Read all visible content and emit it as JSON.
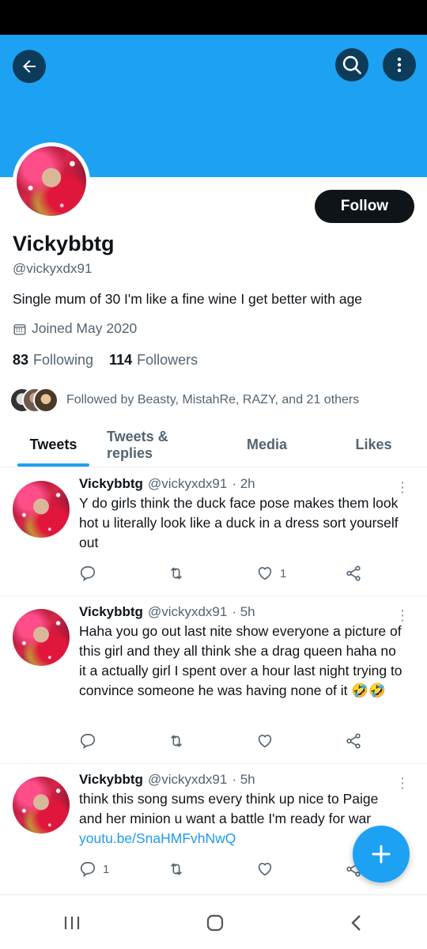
{
  "profile": {
    "display_name": "Vickybbtg",
    "handle": "@vickyxdx91",
    "bio": "Single mum of 30 I'm like a fine wine I get better with age",
    "joined": "Joined May 2020",
    "following_count": "83",
    "following_label": "Following",
    "followers_count": "114",
    "followers_label": "Followers",
    "followed_by": "Followed by Beasty, MistahRe, RAZY, and 21 others",
    "follow_button": "Follow"
  },
  "tabs": [
    {
      "label": "Tweets",
      "active": true
    },
    {
      "label": "Tweets & replies",
      "active": false
    },
    {
      "label": "Media",
      "active": false
    },
    {
      "label": "Likes",
      "active": false
    }
  ],
  "tweets": [
    {
      "name": "Vickybbtg",
      "handle": "@vickyxdx91",
      "time": "· 2h",
      "text": "Y do girls think the duck face pose makes them look hot u literally look like a duck in a dress sort yourself out",
      "link": "",
      "replies": "",
      "retweets": "",
      "likes": "1"
    },
    {
      "name": "Vickybbtg",
      "handle": "@vickyxdx91",
      "time": "· 5h",
      "text": "Haha you go out last nite show everyone a picture of this girl and they all think she a drag queen haha no it a actually girl I spent over a hour last night trying to convince someone he was having none of it 🤣🤣",
      "link": "",
      "replies": "",
      "retweets": "",
      "likes": ""
    },
    {
      "name": "Vickybbtg",
      "handle": "@vickyxdx91",
      "time": "· 5h",
      "text": "think this song sums every think up nice to Paige and her minion u want a battle I'm ready for war",
      "link": "youtu.be/SnaHMFvhNwQ",
      "replies": "1",
      "retweets": "",
      "likes": ""
    }
  ],
  "colors": {
    "brand": "#1da1f2",
    "banner": "#1da1f2",
    "text": "#0f1419",
    "secondary": "#536471",
    "link": "#1d9bf0"
  },
  "icons": {
    "back": "arrow-left-icon",
    "search": "search-icon",
    "menu": "more-vertical-icon",
    "calendar": "calendar-icon",
    "reply": "reply-icon",
    "retweet": "retweet-icon",
    "like": "heart-icon",
    "share": "share-icon",
    "compose": "plus-icon"
  }
}
